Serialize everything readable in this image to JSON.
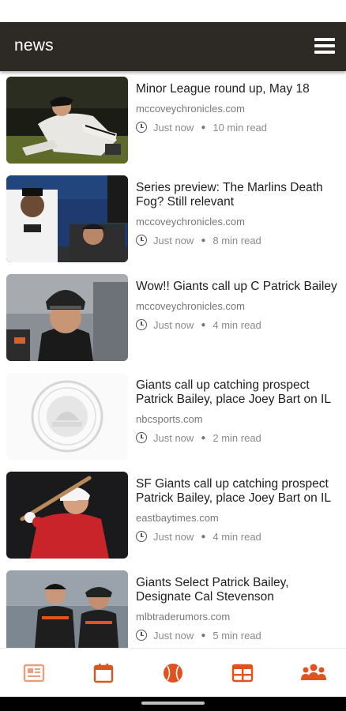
{
  "app": {
    "title": "news",
    "menu_icon": "hamburger-menu-icon",
    "header_color": "#2d2a26",
    "accent_color": "#e0521f"
  },
  "articles": [
    {
      "headline": "Minor League round up, May 18",
      "source": "mccoveychronicles.com",
      "time": "Just now",
      "read_time": "10 min read",
      "image": "pitcher-photo"
    },
    {
      "headline": "Series preview: The Marlins Death Fog? Still relevant",
      "source": "mccoveychronicles.com",
      "time": "Just now",
      "read_time": "8 min read",
      "image": "marlins-players-photo"
    },
    {
      "headline": "Wow!! Giants call up C Patrick Bailey",
      "source": "mccoveychronicles.com",
      "time": "Just now",
      "read_time": "4 min read",
      "image": "catcher-photo"
    },
    {
      "headline": "Giants call up catching prospect Patrick Bailey, place Joey Bart on IL",
      "source": "nbcsports.com",
      "time": "Just now",
      "read_time": "2 min read",
      "image": "city-seal-logo"
    },
    {
      "headline": "SF Giants call up catching prospect Patrick Bailey, place Joey Bart on IL",
      "source": "eastbaytimes.com",
      "time": "Just now",
      "read_time": "4 min read",
      "image": "batter-photo"
    },
    {
      "headline": "Giants Select Patrick Bailey, Designate Cal Stevenson",
      "source": "mlbtraderumors.com",
      "time": "Just now",
      "read_time": "5 min read",
      "image": "giants-players-photo"
    }
  ],
  "bottom_nav": [
    {
      "icon": "newspaper-icon"
    },
    {
      "icon": "calendar-icon"
    },
    {
      "icon": "baseball-icon"
    },
    {
      "icon": "table-icon"
    },
    {
      "icon": "team-icon"
    }
  ]
}
